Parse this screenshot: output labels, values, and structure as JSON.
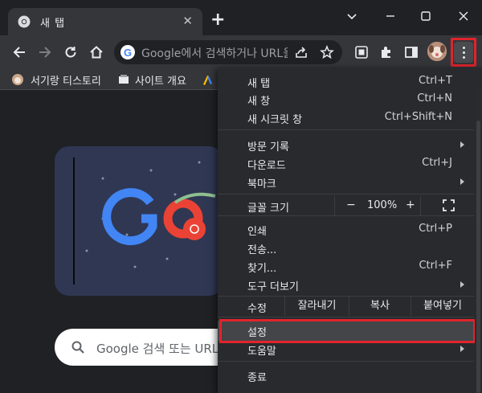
{
  "tab": {
    "title": "새 탭",
    "close": "✕",
    "new_tab": "+"
  },
  "omnibox": {
    "text": "Google에서 검색하거나 URL을 입력하세요",
    "icon": "G"
  },
  "bookmarks": [
    {
      "label": "서기랑 티스토리"
    },
    {
      "label": "사이트 개요"
    }
  ],
  "search": {
    "placeholder": "Google 검색 또는 URL 입력"
  },
  "menu": {
    "new_tab": {
      "label": "새 탭",
      "shortcut": "Ctrl+T"
    },
    "new_window": {
      "label": "새 창",
      "shortcut": "Ctrl+N"
    },
    "incognito": {
      "label": "새 시크릿 창",
      "shortcut": "Ctrl+Shift+N"
    },
    "history": {
      "label": "방문 기록"
    },
    "downloads": {
      "label": "다운로드",
      "shortcut": "Ctrl+J"
    },
    "bookmarks": {
      "label": "북마크"
    },
    "zoom": {
      "label": "글꼴 크기",
      "minus": "−",
      "value": "100%",
      "plus": "+"
    },
    "print": {
      "label": "인쇄",
      "shortcut": "Ctrl+P"
    },
    "cast": {
      "label": "전송..."
    },
    "find": {
      "label": "찾기...",
      "shortcut": "Ctrl+F"
    },
    "more_tools": {
      "label": "도구 더보기"
    },
    "edit": {
      "label": "수정",
      "cut": "잘라내기",
      "copy": "복사",
      "paste": "붙여넣기"
    },
    "settings": {
      "label": "설정"
    },
    "help": {
      "label": "도움말"
    },
    "exit": {
      "label": "종료"
    }
  },
  "colors": {
    "highlight_border": "#e0242c",
    "menu_bg": "#292a2d",
    "toolbar_bg": "#35363a"
  }
}
